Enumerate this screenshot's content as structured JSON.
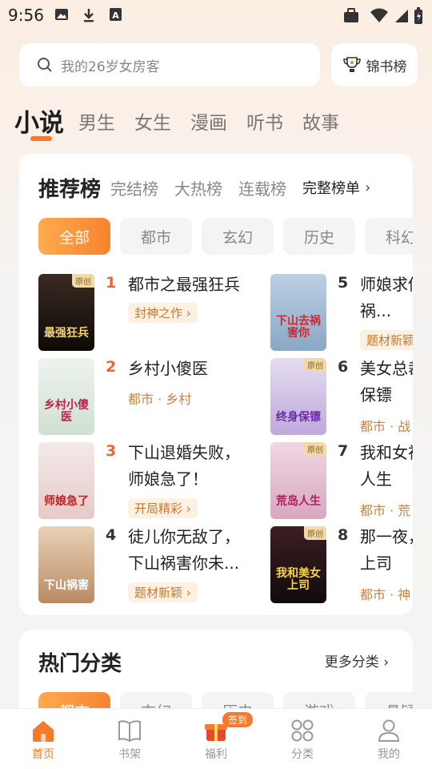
{
  "status_bar": {
    "time": "9:56"
  },
  "search": {
    "placeholder": "我的26岁女房客"
  },
  "rank_button": {
    "label": "锦书榜"
  },
  "top_tabs": [
    "小说",
    "男生",
    "女生",
    "漫画",
    "听书",
    "故事"
  ],
  "rank_tabs": {
    "active": "推荐榜",
    "others": [
      "完结榜",
      "大热榜",
      "连载榜"
    ],
    "full": "完整榜单"
  },
  "chips": [
    "全部",
    "都市",
    "玄幻",
    "历史",
    "科幻"
  ],
  "books": [
    {
      "rank": "1",
      "title": "都市之最强狂兵",
      "tag": "封神之作",
      "cover_text": "最强狂兵",
      "original": "原创"
    },
    {
      "rank": "2",
      "title": "乡村小傻医",
      "sub": "都市 · 乡村",
      "cover_text": "乡村小傻医"
    },
    {
      "rank": "3",
      "title": "下山退婚失败，师娘急了！",
      "tag": "开局精彩",
      "cover_text": "师娘急了"
    },
    {
      "rank": "4",
      "title": "徒儿你无敌了，下山祸害你未...",
      "tag": "题材新颖",
      "cover_text": "下山祸害"
    },
    {
      "rank": "5",
      "title": "师娘求你下山去祸...",
      "tag": "题材新颖",
      "cover_text": "下山去祸害你",
      "original": ""
    },
    {
      "rank": "6",
      "title": "美女总裁的贴身保镖",
      "sub": "都市 · 战",
      "cover_text": "终身保镖",
      "original": "原创"
    },
    {
      "rank": "7",
      "title": "我和女神的荒岛人生",
      "sub": "都市 · 荒",
      "cover_text": "荒岛人生",
      "original": "原创"
    },
    {
      "rank": "8",
      "title": "那一夜，和美女上司",
      "sub": "都市 · 神",
      "cover_text": "我和美女上司",
      "original": "原创"
    }
  ],
  "hot": {
    "title": "热门分类",
    "more": "更多分类",
    "chips": [
      "都市",
      "玄幻",
      "历史",
      "游戏",
      "悬疑"
    ]
  },
  "bottom_nav": [
    {
      "label": "首页",
      "icon": "home-icon"
    },
    {
      "label": "书架",
      "icon": "bookshelf-icon"
    },
    {
      "label": "福利",
      "icon": "gift-icon",
      "badge": "签到"
    },
    {
      "label": "分类",
      "icon": "category-icon"
    },
    {
      "label": "我的",
      "icon": "profile-icon"
    }
  ],
  "colors": {
    "accent": "#f47a2c",
    "tag_text": "#c37a36",
    "tag_bg": "#fdf1e4"
  }
}
